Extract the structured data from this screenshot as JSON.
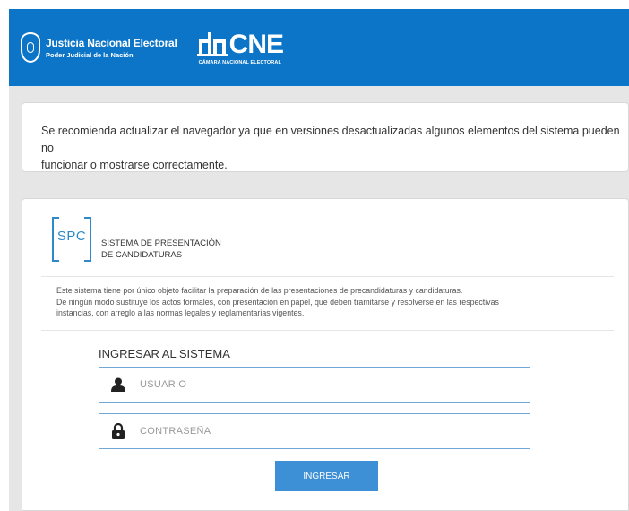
{
  "header": {
    "brand1_title": "Justicia Nacional Electoral",
    "brand1_sub": "Poder Judicial de la Nación",
    "brand2_title": "CNE",
    "brand2_sub": "CÁMARA NACIONAL ELECTORAL",
    "bg_color": "#0c75c7"
  },
  "notice": {
    "text_line1": "Se recomienda actualizar el navegador ya que en versiones desactualizadas algunos elementos del sistema pueden no",
    "text_line2": "funcionar o mostrarse correctamente."
  },
  "card": {
    "logo_text": "SPC",
    "title_line1": "SISTEMA DE PRESENTACIÓN",
    "title_line2": "DE CANDIDATURAS",
    "info_line1": "Este sistema tiene por único objeto facilitar la preparación de las presentaciones de precandidaturas y candidaturas.",
    "info_line2": "De ningún modo sustituye los actos formales, con presentación en papel, que deben tramitarse y resolverse en las respectivas",
    "info_line3": "instancias, con arreglo a las normas legales y reglamentarias vigentes."
  },
  "login": {
    "title": "INGRESAR AL SISTEMA",
    "user_placeholder": "USUARIO",
    "user_icon": "user-icon",
    "password_placeholder": "CONTRASEÑA",
    "password_icon": "lock-icon",
    "submit_label": "INGRESAR",
    "accent_color": "#3d8fd6"
  }
}
